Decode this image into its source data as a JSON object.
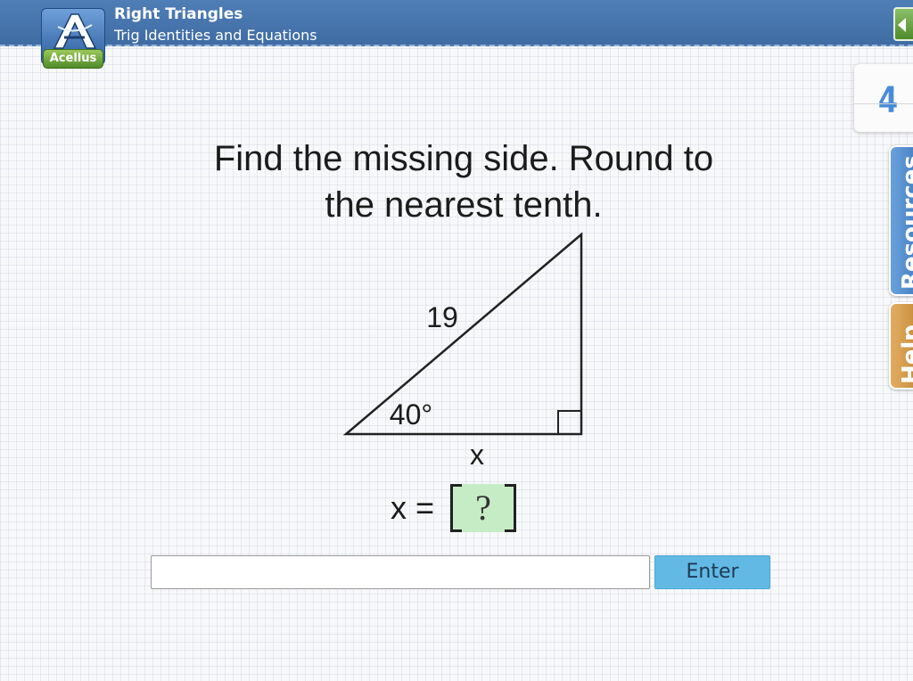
{
  "header": {
    "title": "Right Triangles",
    "subtitle": "Trig Identities and Equations",
    "logo_text": "Acellus",
    "exit_icon": "exit-arrow-icon"
  },
  "sidebar": {
    "page_number": "4",
    "resources_label": "Resources",
    "help_label": "Help"
  },
  "question": {
    "line1": "Find the missing side. Round to",
    "line2": "the nearest tenth."
  },
  "diagram": {
    "hypotenuse_label": "19",
    "angle_label": "40°",
    "base_label": "x",
    "right_angle_marker": "right-angle-square"
  },
  "answer": {
    "variable": "x",
    "equals": "=",
    "placeholder_mark": "?"
  },
  "input": {
    "value": "",
    "placeholder": ""
  },
  "enter_button": {
    "label": "Enter"
  },
  "colors": {
    "header_blue": "#4a78b0",
    "answer_box_green": "#c6ecc6",
    "enter_button_blue": "#62b9e4",
    "page_number_blue": "#4a8bd8",
    "resources_tab": "#4f86c8",
    "help_tab": "#d49a4c"
  }
}
